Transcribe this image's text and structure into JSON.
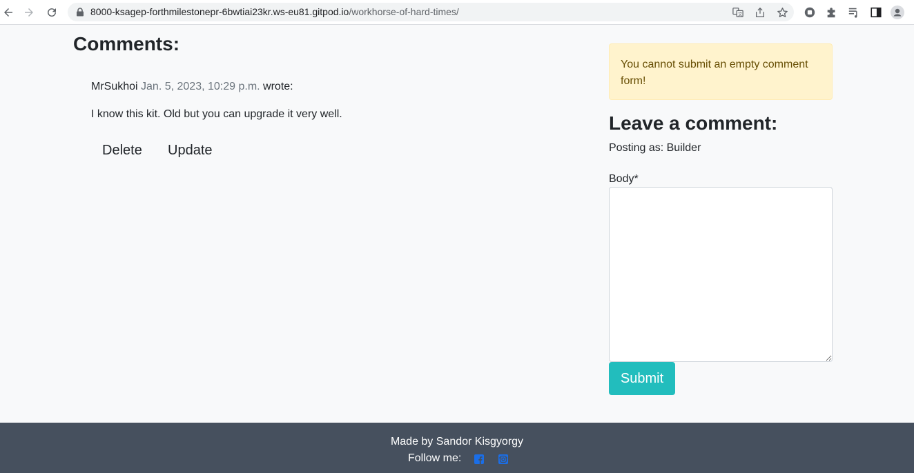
{
  "browser": {
    "url_host": "8000-ksagep-forthmilestonepr-6bwtiai23kr.ws-eu81.gitpod.io",
    "url_path": "/workhorse-of-hard-times/",
    "icons": [
      "back-icon",
      "forward-icon",
      "reload-icon",
      "lock-icon",
      "translate-icon",
      "share-icon",
      "star-icon",
      "extension-circle-icon",
      "puzzle-icon",
      "media-queue-icon",
      "side-panel-icon",
      "profile-icon"
    ]
  },
  "comments": {
    "title": "Comments:",
    "items": [
      {
        "author": "MrSukhoi",
        "date": "Jan. 5, 2023, 10:29 p.m.",
        "wrote": "wrote:",
        "body": "I know this kit. Old but you can upgrade it very well.",
        "delete_label": "Delete",
        "update_label": "Update"
      }
    ]
  },
  "form": {
    "alert_text": "You cannot submit an empty comment form!",
    "title": "Leave a comment:",
    "posting_as": "Posting as: Builder",
    "body_label": "Body*",
    "body_value": "",
    "submit_label": "Submit"
  },
  "footer": {
    "made_by": "Made by Sandor Kisgyorgy",
    "follow_me": "Follow me:",
    "icons": [
      "facebook-icon",
      "instagram-icon"
    ]
  },
  "colors": {
    "page_bg": "#f8f9fa",
    "alert_bg": "#fff3cd",
    "alert_text": "#664d03",
    "submit_bg": "#22bdbd",
    "footer_bg": "#46505e",
    "social_blue": "#1a6ee8"
  }
}
